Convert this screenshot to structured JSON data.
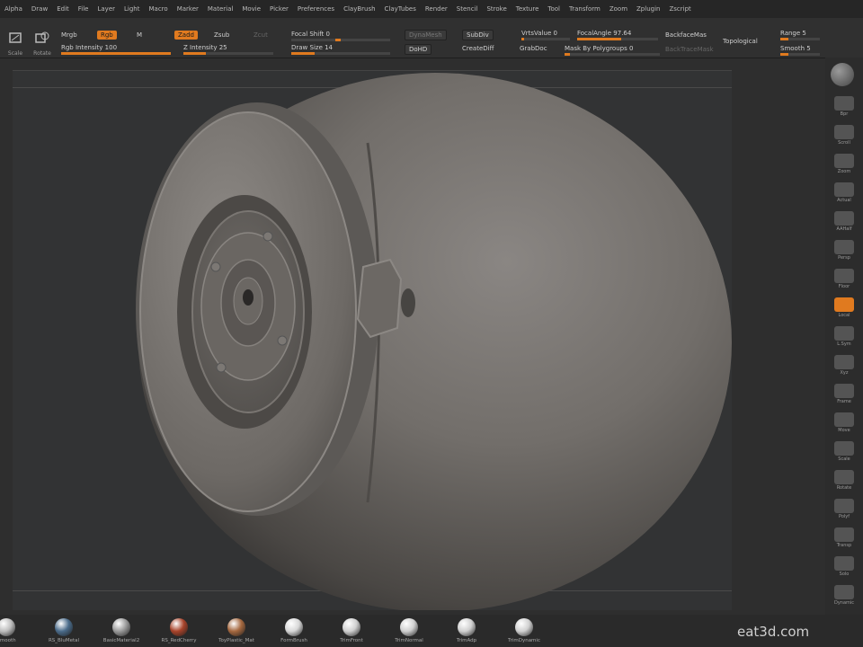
{
  "menu": [
    "Alpha",
    "Draw",
    "Edit",
    "File",
    "Layer",
    "Light",
    "Macro",
    "Marker",
    "Material",
    "Movie",
    "Picker",
    "Preferences",
    "ClayBrush",
    "ClayTubes",
    "Render",
    "Stencil",
    "Stroke",
    "Texture",
    "Tool",
    "Transform",
    "Zoom",
    "Zplugin",
    "Zscript"
  ],
  "toolbar": {
    "scale_label": "Scale",
    "rotate_label": "Rotate",
    "mrgb_label": "Mrgb",
    "rgb_label": "Rgb",
    "m_label": "M",
    "zadd_label": "Zadd",
    "zsub_label": "Zsub",
    "zcut_label": "Zcut",
    "rgb_intensity": "Rgb Intensity 100",
    "z_intensity": "Z Intensity 25",
    "focal_shift": "Focal Shift 0",
    "draw_size": "Draw Size 14",
    "dots_label": "DynaMesh",
    "dohd_label": "DoHD",
    "switch_label": "SubDiv",
    "create_label": "CreateDiff",
    "grab_label": "GrabDoc",
    "vrs_label": "VrtsValue 0",
    "focal_angle": "FocalAngle 97.64",
    "mask_label": "Mask By Polygroups 0",
    "backface": "BackfaceMas",
    "topological": "Topological",
    "range": "Range 5",
    "smooth": "Smooth 5",
    "backtrace": "BackTraceMask"
  },
  "toolbar_values": {
    "rgb_intensity": 100,
    "z_intensity": 25,
    "focal_shift": 0,
    "draw_size": 14,
    "range": 5,
    "smooth": 5
  },
  "rightbar": [
    "Bpr",
    "Scroll",
    "Zoom",
    "Actual",
    "AAHalf",
    "Persp",
    "Floor",
    "Local",
    "L.Sym",
    "Xyz",
    "Frame",
    "Move",
    "Scale",
    "Rotate",
    "Polyf",
    "Transp",
    "Solo",
    "Dynamic"
  ],
  "materials": [
    {
      "name": "Smooth",
      "color": "#bdbdbd"
    },
    {
      "name": "RS_BluMetal",
      "color": "#4a6b8a"
    },
    {
      "name": "BasicMaterial2",
      "color": "#9a9a9a"
    },
    {
      "name": "RS_RedCherry",
      "color": "#a8432a"
    },
    {
      "name": "ToyPlastic_Mat",
      "color": "#a5683f"
    },
    {
      "name": "FormBrush",
      "color": "#d8d8d8"
    },
    {
      "name": "TrimFront",
      "color": "#d0d0d0"
    },
    {
      "name": "TrimNormal",
      "color": "#d0d0d0"
    },
    {
      "name": "TrimAdp",
      "color": "#d0d0d0"
    },
    {
      "name": "TrimDynamic",
      "color": "#d0d0d0"
    }
  ],
  "watermark": "eat3d.com",
  "colors": {
    "accent": "#e07a1f",
    "mesh": "#6a6763",
    "background": "#323334"
  }
}
